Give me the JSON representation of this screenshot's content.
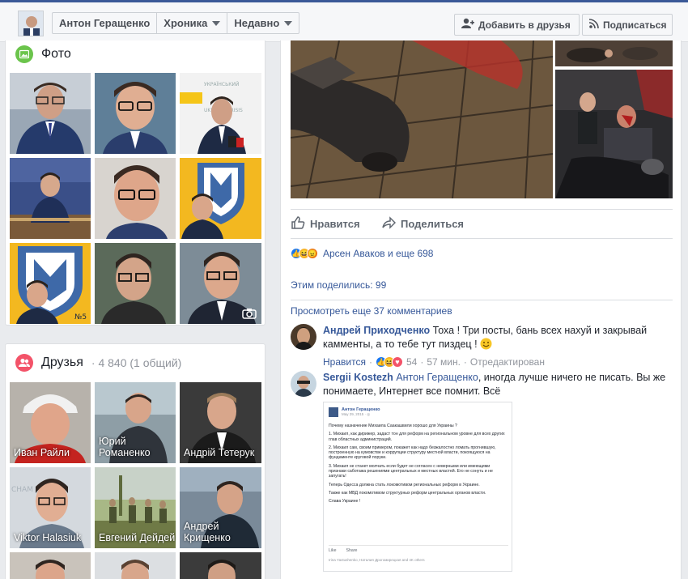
{
  "header": {
    "profile_name": "Антон Геращенко",
    "nav_timeline": "Хроника",
    "nav_recent": "Недавно",
    "add_friend": "Добавить в друзья",
    "subscribe": "Подписаться"
  },
  "photos": {
    "title": "Фото"
  },
  "friends": {
    "title": "Друзья",
    "count": "· 4 840 (1 общий)",
    "items": [
      {
        "name": "Иван Райли"
      },
      {
        "name": "Юрий Романенко"
      },
      {
        "name": "Андрій Тетерук"
      },
      {
        "name": "Viktor Halasiuk"
      },
      {
        "name": "Евгений Дейдей"
      },
      {
        "name": "Андрей Крищенко"
      }
    ]
  },
  "post": {
    "like_label": "Нравится",
    "share_label": "Поделиться",
    "reactions_text": "Арсен Аваков и еще 698",
    "shares_text": "Этим поделились: 99",
    "more_comments": "Просмотреть еще 37 комментариев",
    "comments": [
      {
        "author": "Андрей Приходченко",
        "text": "Тоха ! Три посты, бань всех нахуй и закрывай камменты, а то тебе тут пиздец !",
        "like_label": "Нравится",
        "reaction_count": "54",
        "time": "57 мин.",
        "edited": "Отредактирован"
      },
      {
        "author": "Sergii Kostezh",
        "text_link": "Антон Геращенко",
        "text": ", иногда лучше ничего не писать. Вы же понимаете, Интернет все помнит. Всё"
      }
    ],
    "embed": {
      "author": "Антон Геращенко",
      "date": "May 29, 2015 · ◎",
      "paragraphs": [
        "Почему назначение Михаила Саакашвили хорошо для Украины ?",
        "1. Михаил, как дирижер, задаст тон для реформ на региональном уровне для всех других глав областных администраций.",
        "2. Михаил сам, своим примером, покажет как надо безжалостно ломать прогнившую, построенную на кумовстве и коррупции структуру местной власти, покоящуюся на фундаменте круговой поруки.",
        "3. Михаил не станет молчать если будет не согласен с неверными или имеющими признаки саботажа решениями центральных и местных властей. Его не сонуть и не запугать!",
        "Теперь Одесса должна стать локомотивом региональных реформ в Украине.",
        "Также как МВД локомотивом структурных реформ центральных органов власти.",
        "Слава Украине !"
      ],
      "like": "Like",
      "share": "Share",
      "reactions": "Irina Yavtushenko, Наталия Дрогомирецкая and 4K others"
    }
  },
  "colors": {
    "brand_blue": "#3b5998",
    "link": "#365899",
    "photos_icon": "#6bc44c",
    "friends_icon": "#f35369"
  }
}
